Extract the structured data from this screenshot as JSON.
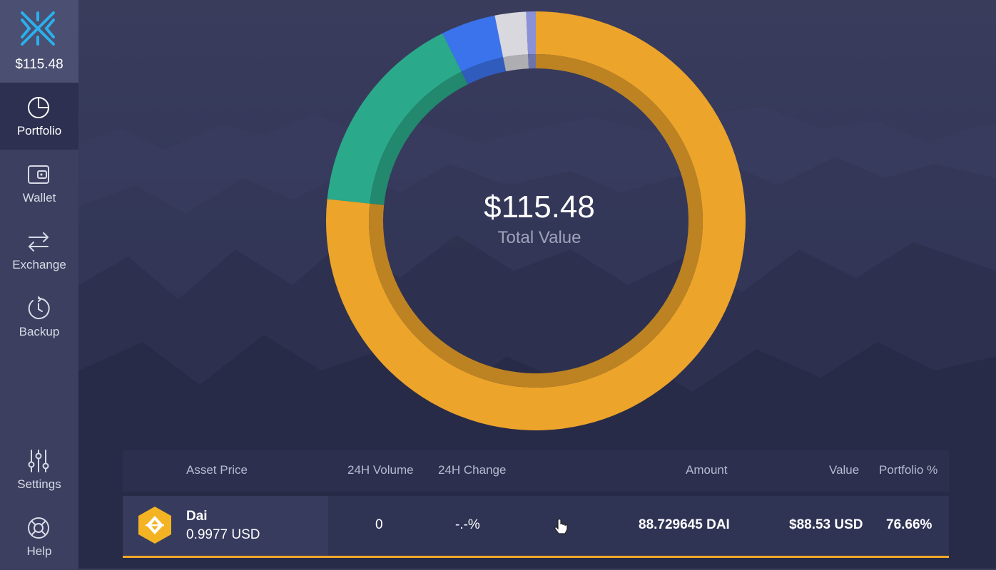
{
  "app": {
    "total_balance": "$115.48"
  },
  "sidebar": {
    "items": [
      {
        "label": "Portfolio",
        "icon": "pie-chart-icon",
        "active": true
      },
      {
        "label": "Wallet",
        "icon": "wallet-icon",
        "active": false
      },
      {
        "label": "Exchange",
        "icon": "exchange-arrows-icon",
        "active": false
      },
      {
        "label": "Backup",
        "icon": "backup-clock-icon",
        "active": false
      }
    ],
    "bottom_items": [
      {
        "label": "Settings",
        "icon": "sliders-icon"
      },
      {
        "label": "Help",
        "icon": "lifebuoy-icon"
      }
    ]
  },
  "portfolio": {
    "total_value": "$115.48",
    "total_label": "Total Value"
  },
  "chart_data": {
    "type": "pie",
    "series": [
      {
        "name": "Dai",
        "value": 76.66,
        "color": "#eca42a"
      },
      {
        "value": 16.0,
        "color": "#2aaa8a"
      },
      {
        "value": 4.2,
        "color": "#3b73ec"
      },
      {
        "value": 2.4,
        "color": "#d8d8de"
      },
      {
        "value": 0.74,
        "color": "#8a91d6"
      }
    ]
  },
  "table": {
    "headers": {
      "asset_price": "Asset Price",
      "volume": "24H Volume",
      "change": "24H Change",
      "amount": "Amount",
      "value": "Value",
      "portfolio_pct": "Portfolio %"
    },
    "rows": [
      {
        "name": "Dai",
        "price": "0.9977 USD",
        "volume": "0",
        "change": "-.-%",
        "amount": "88.729645 DAI",
        "value": "$88.53 USD",
        "portfolio_pct": "76.66%"
      }
    ]
  },
  "colors": {
    "accent": "#f0a92a",
    "sidebar": "#3c3f5f",
    "logo": "#2ab0ec"
  }
}
